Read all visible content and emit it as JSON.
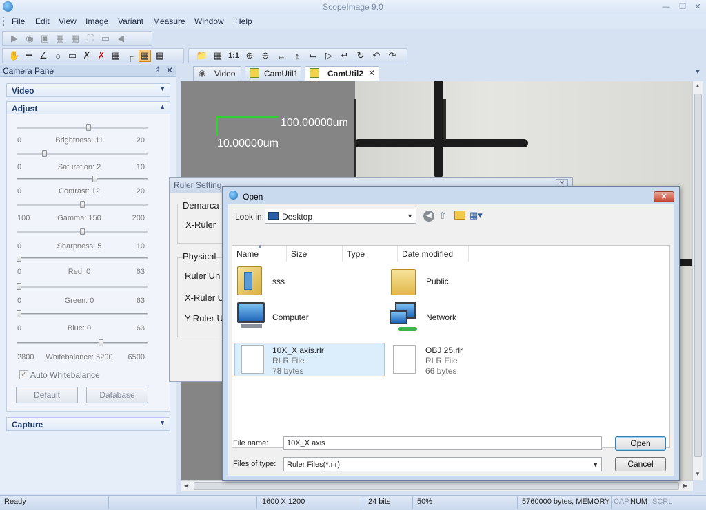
{
  "window": {
    "title": "ScopeImage 9.0"
  },
  "menu": [
    "File",
    "Edit",
    "View",
    "Image",
    "Variant",
    "Measure",
    "Window",
    "Help"
  ],
  "camera_pane": {
    "title": "Camera Pane",
    "sections": {
      "video": "Video",
      "adjust": "Adjust",
      "capture": "Capture"
    },
    "sliders": [
      {
        "name": "Brightness",
        "min": "0",
        "max": "20",
        "value": 11,
        "label": "Brightness: 11"
      },
      {
        "name": "Saturation",
        "min": "0",
        "max": "10",
        "value": 2,
        "label": "Saturation: 2"
      },
      {
        "name": "Contrast",
        "min": "0",
        "max": "20",
        "value": 12,
        "label": "Contrast: 12"
      },
      {
        "name": "Gamma",
        "min": "100",
        "max": "200",
        "value": 150,
        "label": "Gamma: 150"
      },
      {
        "name": "Sharpness",
        "min": "0",
        "max": "10",
        "value": 5,
        "label": "Sharpness: 5"
      },
      {
        "name": "Red",
        "min": "0",
        "max": "63",
        "value": 0,
        "label": "Red: 0"
      },
      {
        "name": "Green",
        "min": "0",
        "max": "63",
        "value": 0,
        "label": "Green: 0"
      },
      {
        "name": "Blue",
        "min": "0",
        "max": "63",
        "value": 0,
        "label": "Blue: 0"
      },
      {
        "name": "Whitebalance",
        "min": "2800",
        "max": "6500",
        "value": 5200,
        "label": "Whitebalance: 5200"
      }
    ],
    "auto_whitebalance": {
      "label": "Auto Whitebalance",
      "checked": true
    },
    "buttons": {
      "default": "Default",
      "database": "Database"
    }
  },
  "tabs": [
    {
      "label": "Video",
      "active": false
    },
    {
      "label": "CamUtil1",
      "active": false
    },
    {
      "label": "CamUtil2",
      "active": true
    }
  ],
  "canvas": {
    "ruler_x": "100.00000um",
    "ruler_y": "10.00000um"
  },
  "ruler_dialog": {
    "title": "Ruler Setting",
    "labels": {
      "demarcation": "Demarca",
      "x_ruler": "X-Ruler",
      "physical": "Physical",
      "ruler_unit": "Ruler Un",
      "x_ruler_u": "X-Ruler U",
      "y_ruler_u": "Y-Ruler U"
    }
  },
  "open_dialog": {
    "title": "Open",
    "look_in_label": "Look in:",
    "look_in_value": "Desktop",
    "columns": [
      "Name",
      "Size",
      "Type",
      "Date modified"
    ],
    "items": [
      {
        "name": "sss",
        "icon": "user-folder-icon"
      },
      {
        "name": "Public",
        "icon": "folder-icon"
      },
      {
        "name": "Computer",
        "icon": "computer-icon"
      },
      {
        "name": "Network",
        "icon": "network-icon"
      },
      {
        "name": "10X_X axis.rlr",
        "type": "RLR File",
        "size": "78 bytes",
        "icon": "file-icon",
        "selected": true
      },
      {
        "name": "OBJ 25.rlr",
        "type": "RLR File",
        "size": "66 bytes",
        "icon": "file-icon",
        "selected": false
      }
    ],
    "file_name_label": "File name:",
    "file_name_value": "10X_X axis",
    "files_of_type_label": "Files of type:",
    "files_of_type_value": "Ruler Files(*.rlr)",
    "open_button": "Open",
    "cancel_button": "Cancel"
  },
  "status": {
    "ready": "Ready",
    "resolution": "1600 X 1200",
    "bits": "24 bits",
    "zoom": "50%",
    "memory": "5760000 bytes, MEMORY",
    "cap": "CAP",
    "num": "NUM",
    "scrl": "SCRL"
  }
}
